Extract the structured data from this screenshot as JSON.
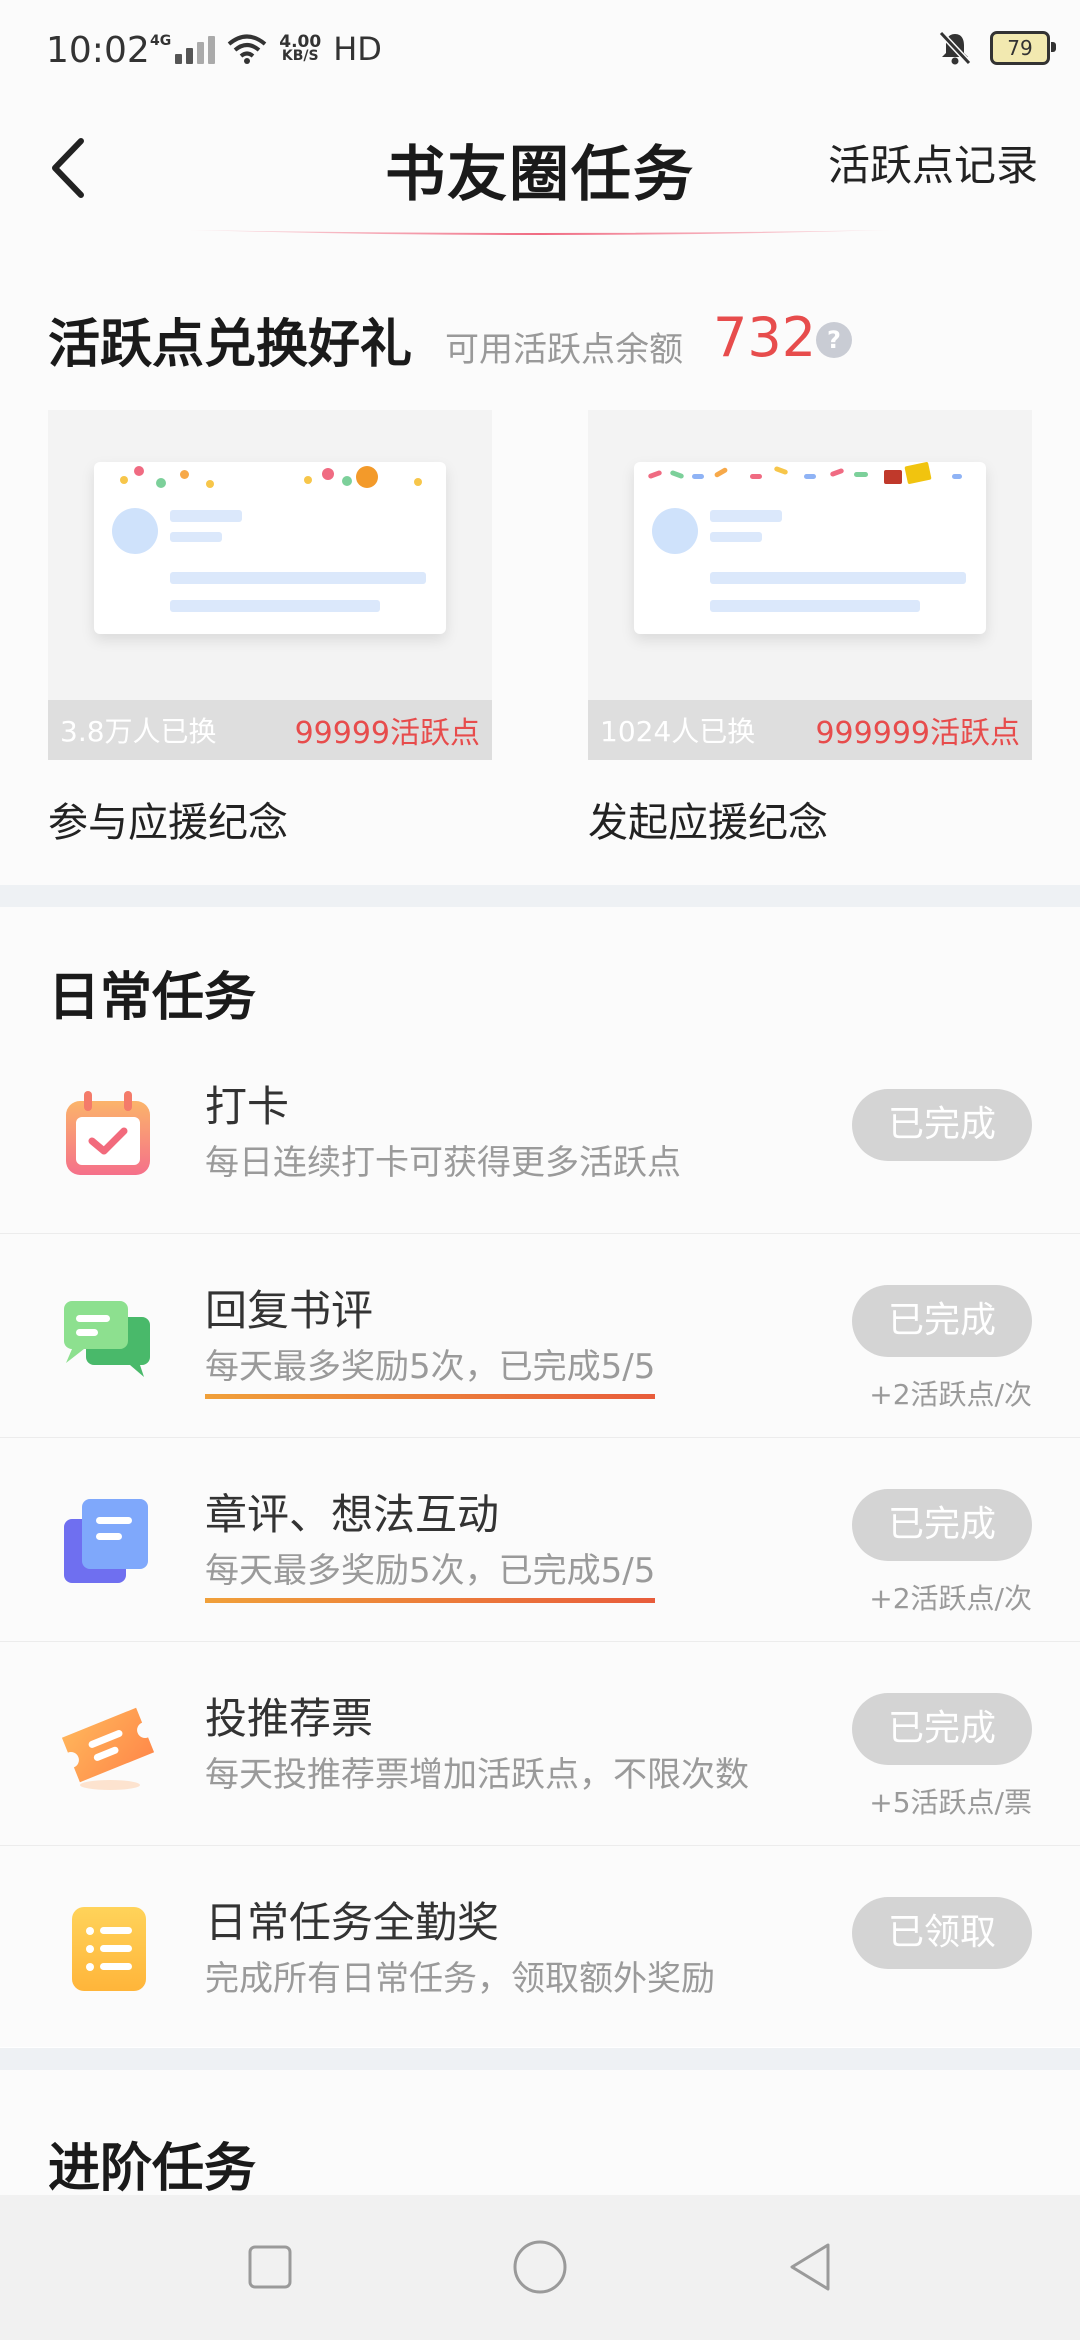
{
  "status_bar": {
    "time": "10:02",
    "network": "4G",
    "speed_value": "4.00",
    "speed_unit": "KB/S",
    "hd": "HD",
    "battery": "79"
  },
  "header": {
    "title": "书友圈任务",
    "record_link": "活跃点记录"
  },
  "exchange": {
    "title": "活跃点兑换好礼",
    "balance_label": "可用活跃点余额",
    "balance_value": "732",
    "help_icon": "?",
    "gifts": [
      {
        "count": "3.8万人已换",
        "price": "99999活跃点",
        "name": "参与应援纪念"
      },
      {
        "count": "1024人已换",
        "price": "999999活跃点",
        "name": "发起应援纪念"
      }
    ]
  },
  "daily": {
    "title": "日常任务",
    "tasks": [
      {
        "name": "打卡",
        "desc": "每日连续打卡可获得更多活跃点",
        "button": "已完成",
        "reward": "",
        "icon": "calendar-check-icon"
      },
      {
        "name": "回复书评",
        "desc": "每天最多奖励5次，已完成5/5",
        "button": "已完成",
        "reward": "+2活跃点/次",
        "icon": "chat-bubbles-icon"
      },
      {
        "name": "章评、想法互动",
        "desc": "每天最多奖励5次，已完成5/5",
        "button": "已完成",
        "reward": "+2活跃点/次",
        "icon": "note-cards-icon"
      },
      {
        "name": "投推荐票",
        "desc": "每天投推荐票增加活跃点，不限次数",
        "button": "已完成",
        "reward": "+5活跃点/票",
        "icon": "ticket-icon"
      },
      {
        "name": "日常任务全勤奖",
        "desc": "完成所有日常任务，领取额外奖励",
        "button": "已领取",
        "reward": "",
        "icon": "list-clipboard-icon"
      }
    ]
  },
  "advanced": {
    "title": "进阶任务"
  },
  "colors": {
    "accent_red": "#e74c4c",
    "button_grey": "#d4d4d4",
    "underline_orange": "#ee7a3b"
  }
}
